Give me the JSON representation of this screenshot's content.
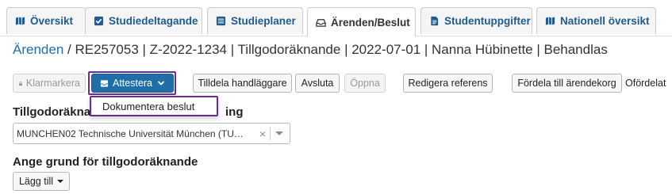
{
  "tabs": [
    {
      "label": "Översikt",
      "icon": "map-icon",
      "active": false
    },
    {
      "label": "Studiedeltagande",
      "icon": "checkbox-icon",
      "active": false
    },
    {
      "label": "Studieplaner",
      "icon": "list-icon",
      "active": false
    },
    {
      "label": "Ärenden/Beslut",
      "icon": "inbox-icon",
      "active": true
    },
    {
      "label": "Studentuppgifter",
      "icon": "document-icon",
      "active": false
    },
    {
      "label": "Nationell översikt",
      "icon": "map-icon",
      "active": false
    }
  ],
  "breadcrumb": {
    "link": "Ärenden",
    "rest": " / RE257053 | Z-2022-1234 | Tillgodoräknande | 2022-07-01 | Nanna Hübinette | Behandlas"
  },
  "toolbar": {
    "klarmarkera": "Klarmarkera",
    "attestera": "Attestera",
    "tilldela": "Tilldela handläggare",
    "avsluta": "Avsluta",
    "oppna": "Öppna",
    "redigera": "Redigera referens",
    "fordela": "Fördela till ärendekorg",
    "status": "Ofördelat"
  },
  "attestera_menu": {
    "items": [
      "Dokumentera beslut"
    ]
  },
  "form": {
    "tillgodo_label": "Tillgodoräknas",
    "tillgodo_label_suffix": "ing",
    "tillgodo_value": "MUNCHEN02 Technische Universität München (TU…",
    "grund_label": "Ange grund för tillgodoräknande",
    "lagg_till": "Lägg till"
  },
  "colors": {
    "primary": "#1f6ea8",
    "tab_text": "#1f5b8f",
    "focus_outline": "#6b2c91"
  }
}
